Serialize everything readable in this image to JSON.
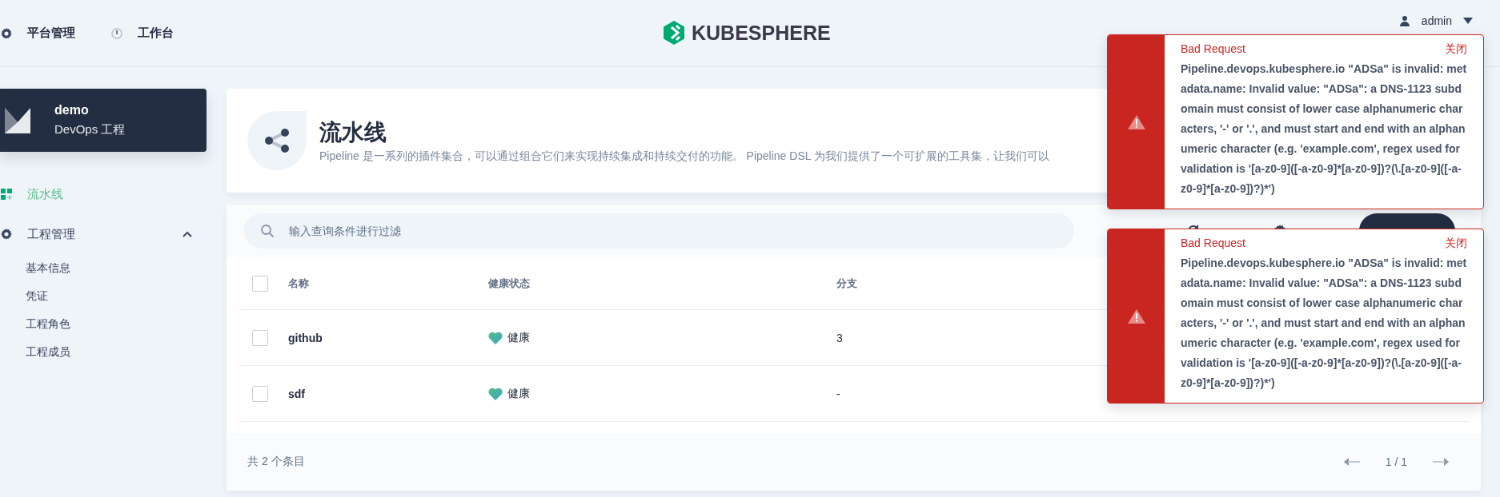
{
  "top_nav": {
    "items": [
      {
        "label": "平台管理",
        "kind": "gear"
      },
      {
        "label": "工作台",
        "kind": "dial"
      }
    ],
    "logo": "KUBESPHERE",
    "user": "admin"
  },
  "project": {
    "name": "demo",
    "type": "DevOps 工程"
  },
  "sidebar": {
    "items": [
      {
        "label": "流水线",
        "kind": "grid",
        "selected": true
      },
      {
        "label": "工程管理",
        "kind": "gear",
        "selected": false,
        "expanded": true,
        "children": [
          {
            "label": "基本信息",
            "selected": false
          },
          {
            "label": "凭证",
            "selected": false
          },
          {
            "label": "工程角色",
            "selected": false
          },
          {
            "label": "工程成员",
            "selected": false
          }
        ]
      }
    ]
  },
  "page_header": {
    "title": "流水线",
    "description": "Pipeline 是一系列的插件集合，可以通过组合它们来实现持续集成和持续交付的功能。 Pipeline DSL 为我们提供了一个可扩展的工具集，让我们可以"
  },
  "toolbar": {
    "search": {
      "placeholder": "输入查询条件进行过滤"
    }
  },
  "table": {
    "header_checked": false,
    "columns": [
      "名称",
      "健康状态",
      "分支"
    ],
    "rows": [
      {
        "name": "github",
        "health": "健康",
        "branches": "3",
        "checked": false
      },
      {
        "name": "sdf",
        "health": "健康",
        "branches": "-",
        "checked": false
      }
    ]
  },
  "footer": {
    "total": "共 2 个条目",
    "page": "1 / 1"
  },
  "notifications": [
    {
      "title": "Bad Request",
      "close": "关闭",
      "message": "Pipeline.devops.kubesphere.io \"ADSa\" is invalid: metadata.name: Invalid value: \"ADSa\": a DNS-1123 subdomain must consist of lower case alphanumeric characters, '-' or '.', and must start and end with an alphanumeric character (e.g. 'example.com', regex used for validation is '[a-z0-9]([-a-z0-9]*[a-z0-9])?(\\.[a-z0-9]([-a-z0-9]*[a-z0-9])?)*')"
    },
    {
      "title": "Bad Request",
      "close": "关闭",
      "message": "Pipeline.devops.kubesphere.io \"ADSa\" is invalid: metadata.name: Invalid value: \"ADSa\": a DNS-1123 subdomain must consist of lower case alphanumeric characters, '-' or '.', and must start and end with an alphanumeric character (e.g. 'example.com', regex used for validation is '[a-z0-9]([-a-z0-9]*[a-z0-9])?(\\.[a-z0-9]([-a-z0-9]*[a-z0-9])?)*')"
    }
  ]
}
